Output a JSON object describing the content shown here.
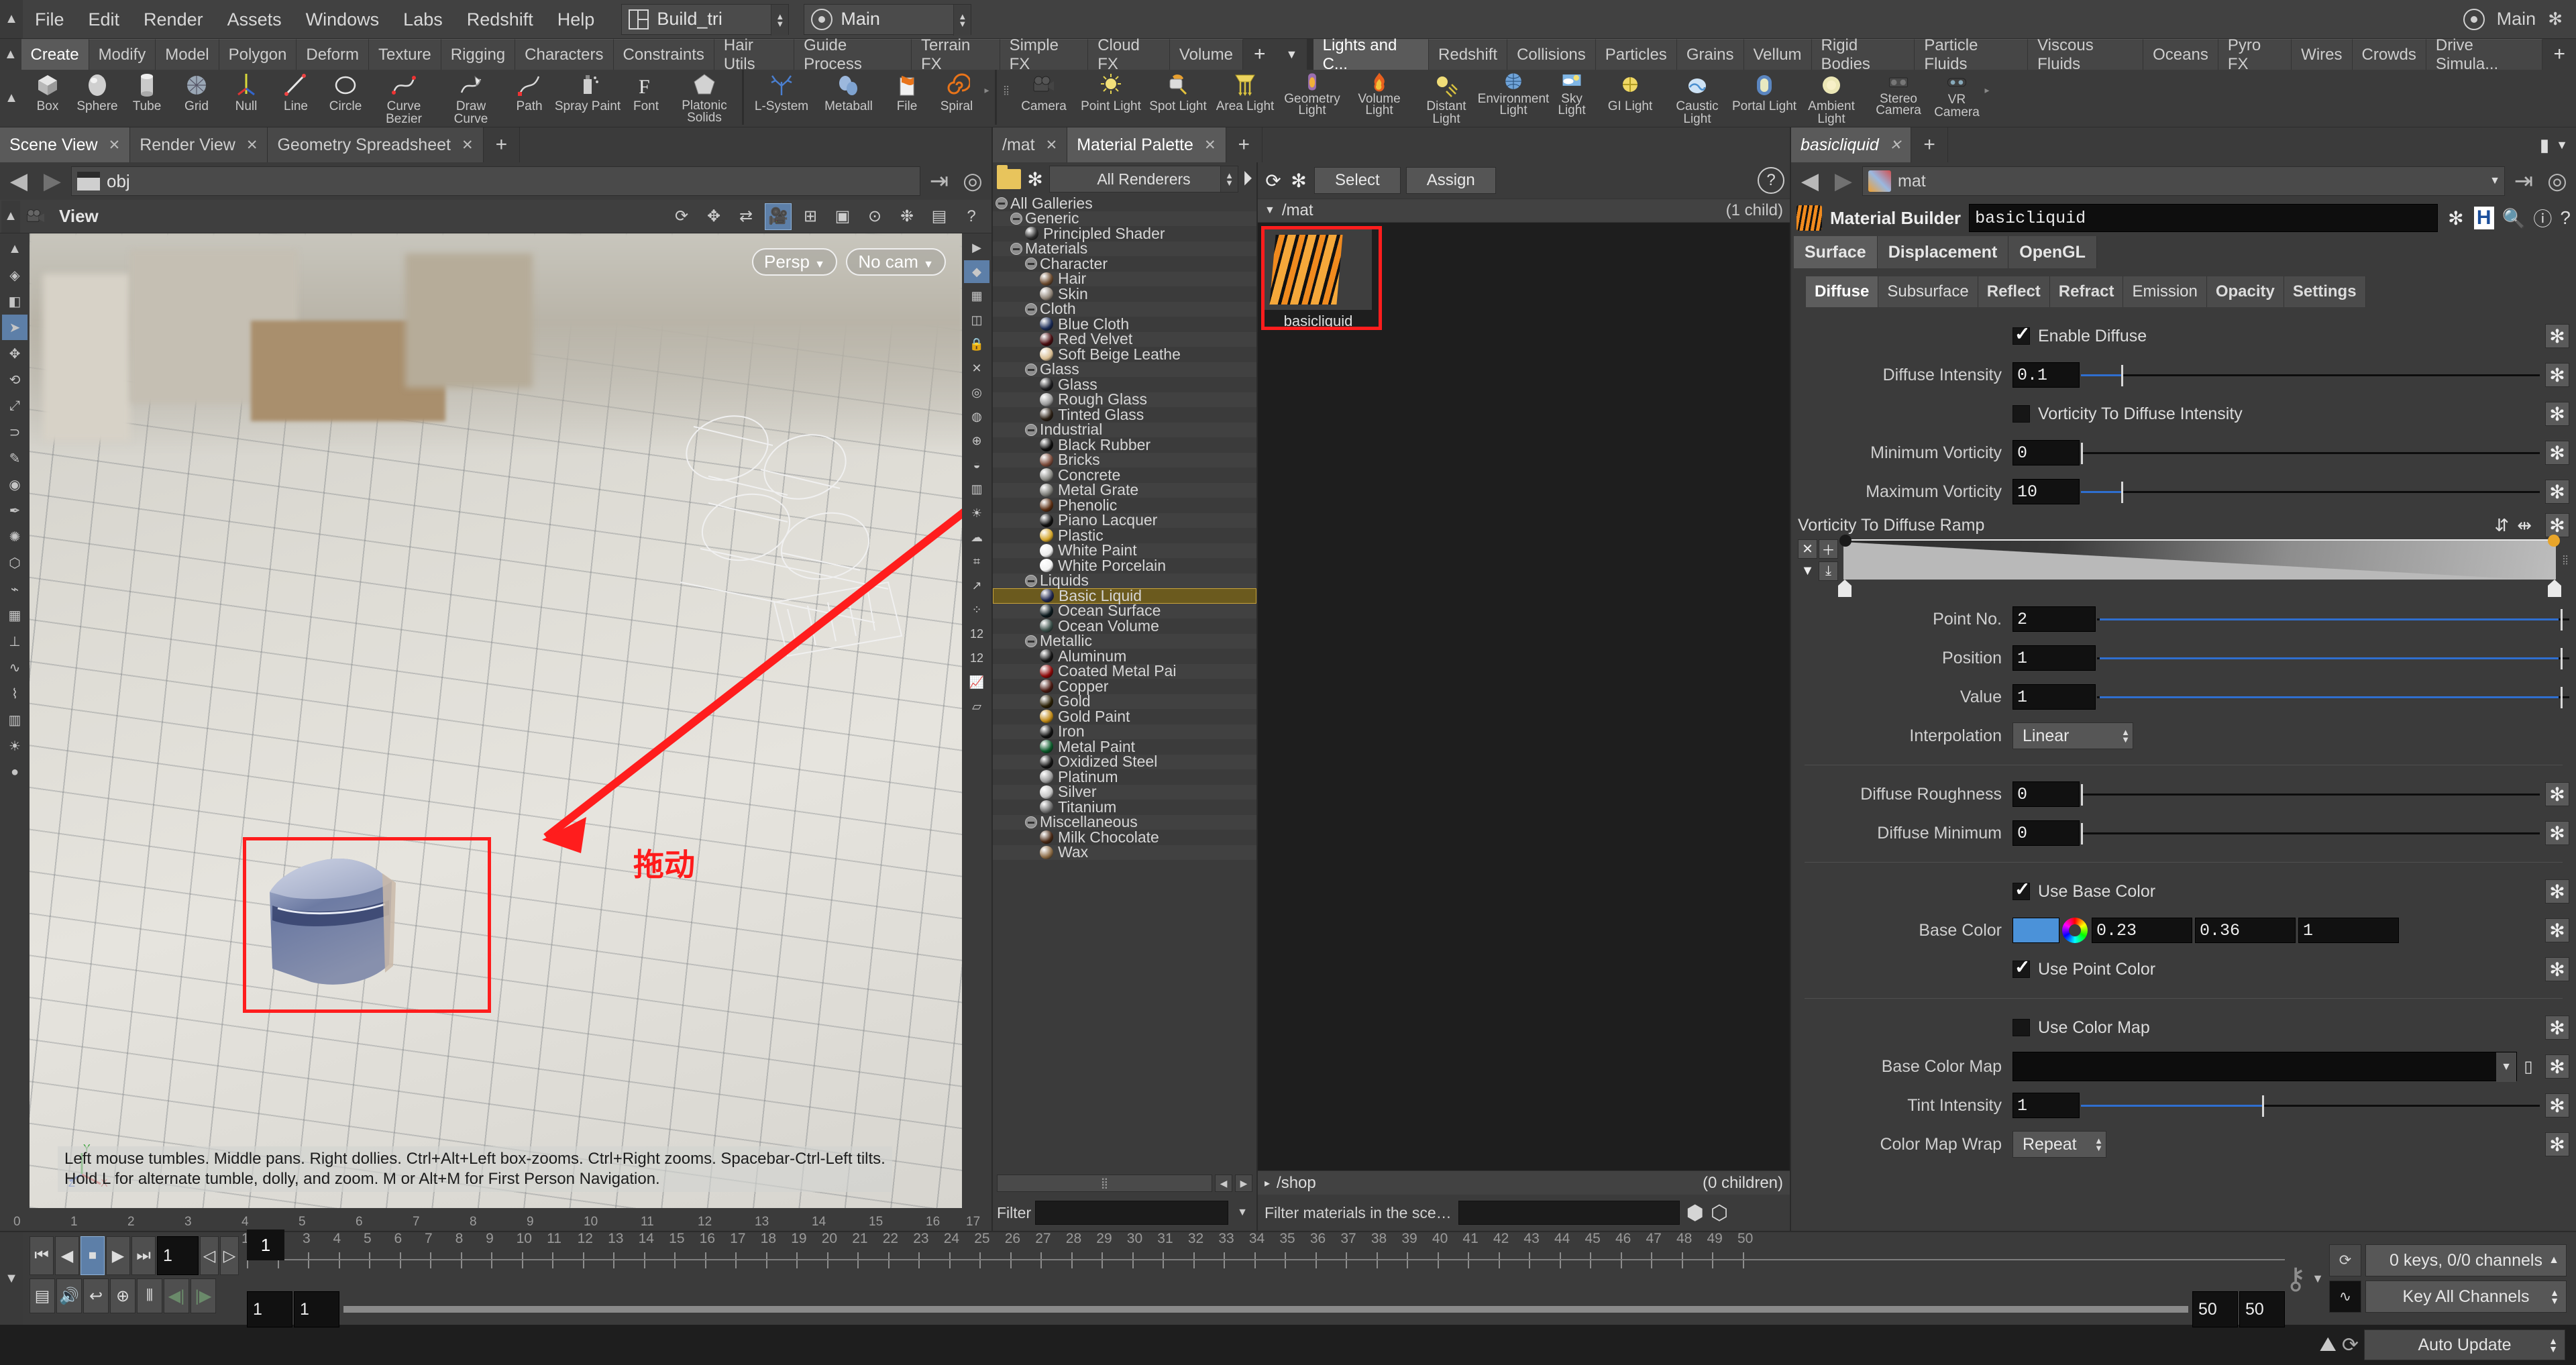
{
  "menubar": {
    "items": [
      "File",
      "Edit",
      "Render",
      "Assets",
      "Windows",
      "Labs",
      "Redshift",
      "Help"
    ],
    "desktop": "Build_tri",
    "viewport_layout": "Main",
    "right_layout": "Main"
  },
  "shelf": {
    "tabs_left": [
      "Create",
      "Modify",
      "Model",
      "Polygon",
      "Deform",
      "Texture",
      "Rigging",
      "Characters",
      "Constraints",
      "Hair Utils",
      "Guide Process",
      "Terrain FX",
      "Simple FX",
      "Cloud FX",
      "Volume"
    ],
    "active_left": "Create",
    "plus": "+",
    "caret": "▼",
    "tabs_right": [
      "Lights and C...",
      "Redshift",
      "Collisions",
      "Particles",
      "Grains",
      "Vellum",
      "Rigid Bodies",
      "Particle Fluids",
      "Viscous Fluids",
      "Oceans",
      "Pyro FX",
      "Wires",
      "Crowds",
      "Drive Simula..."
    ],
    "active_right": "Lights and C...",
    "tools_left": [
      {
        "label": "Box",
        "icon": "box-icon"
      },
      {
        "label": "Sphere",
        "icon": "sphere-icon"
      },
      {
        "label": "Tube",
        "icon": "tube-icon"
      },
      {
        "label": "Grid",
        "icon": "grid-icon"
      },
      {
        "label": "Null",
        "icon": "null-icon"
      },
      {
        "label": "Line",
        "icon": "line-icon"
      },
      {
        "label": "Circle",
        "icon": "circle-icon"
      },
      {
        "label": "Curve Bezier",
        "icon": "curve-bezier-icon"
      },
      {
        "label": "Draw Curve",
        "icon": "draw-curve-icon"
      },
      {
        "label": "Path",
        "icon": "path-icon"
      },
      {
        "label": "Spray Paint",
        "icon": "spray-paint-icon"
      },
      {
        "label": "Font",
        "icon": "font-icon"
      },
      {
        "label": "Platonic Solids",
        "icon": "platonic-solids-icon"
      },
      {
        "label": "L-System",
        "icon": "l-system-icon"
      },
      {
        "label": "Metaball",
        "icon": "metaball-icon"
      },
      {
        "label": "File",
        "icon": "file-icon"
      },
      {
        "label": "Spiral",
        "icon": "spiral-icon"
      }
    ],
    "tools_right": [
      {
        "label": "Camera",
        "icon": "camera-icon"
      },
      {
        "label": "Point Light",
        "icon": "point-light-icon"
      },
      {
        "label": "Spot Light",
        "icon": "spot-light-icon"
      },
      {
        "label": "Area Light",
        "icon": "area-light-icon"
      },
      {
        "label": "Geometry Light",
        "icon": "geometry-light-icon"
      },
      {
        "label": "Volume Light",
        "icon": "volume-light-icon"
      },
      {
        "label": "Distant Light",
        "icon": "distant-light-icon"
      },
      {
        "label": "Environment Light",
        "icon": "environment-light-icon"
      },
      {
        "label": "Sky Light",
        "icon": "sky-light-icon"
      },
      {
        "label": "GI Light",
        "icon": "gi-light-icon"
      },
      {
        "label": "Caustic Light",
        "icon": "caustic-light-icon"
      },
      {
        "label": "Portal Light",
        "icon": "portal-light-icon"
      },
      {
        "label": "Ambient Light",
        "icon": "ambient-light-icon"
      },
      {
        "label": "Stereo Camera",
        "icon": "stereo-camera-icon"
      },
      {
        "label": "VR Camera",
        "icon": "vr-camera-icon"
      }
    ]
  },
  "scene_pane": {
    "tabs": [
      "Scene View",
      "Render View",
      "Geometry Spreadsheet"
    ],
    "active_tab": "Scene View",
    "path": "obj",
    "view_label": "View",
    "persp_label": "Persp",
    "cam_label": "No cam",
    "annotation_cn": "拖动",
    "help_line1": "Left mouse tumbles. Middle pans. Right dollies. Ctrl+Alt+Left box-zooms. Ctrl+Right zooms. Spacebar-Ctrl-Left tilts.",
    "help_line2": "Hold L for alternate tumble, dolly, and zoom.     M or Alt+M for First Person Navigation.",
    "ruler_ticks": [
      "0",
      "1",
      "2",
      "3",
      "4",
      "5",
      "6",
      "7",
      "8",
      "9",
      "10",
      "11",
      "12",
      "13",
      "14",
      "15",
      "16",
      "17"
    ]
  },
  "gallery": {
    "renderer_filter": "All Renderers",
    "filter_label": "Filter",
    "filter_value": "",
    "tree": [
      {
        "label": "All Galleries",
        "depth": 0,
        "type": "node"
      },
      {
        "label": "Generic",
        "depth": 1,
        "type": "node"
      },
      {
        "label": "Principled Shader",
        "depth": 2,
        "type": "leaf",
        "color": "#2c2c2c"
      },
      {
        "label": "Materials",
        "depth": 1,
        "type": "node"
      },
      {
        "label": "Character",
        "depth": 2,
        "type": "node"
      },
      {
        "label": "Hair",
        "depth": 3,
        "type": "leaf",
        "color": "#6b4a2e"
      },
      {
        "label": "Skin",
        "depth": 3,
        "type": "leaf",
        "color": "#8f8478"
      },
      {
        "label": "Cloth",
        "depth": 2,
        "type": "node"
      },
      {
        "label": "Blue Cloth",
        "depth": 3,
        "type": "leaf",
        "color": "#1a2a55"
      },
      {
        "label": "Red Velvet",
        "depth": 3,
        "type": "leaf",
        "color": "#4a0d10"
      },
      {
        "label": "Soft Beige Leathe",
        "depth": 3,
        "type": "leaf",
        "color": "#d8bd92"
      },
      {
        "label": "Glass",
        "depth": 2,
        "type": "node"
      },
      {
        "label": "Glass",
        "depth": 3,
        "type": "leaf",
        "color": "#1d1d1f"
      },
      {
        "label": "Rough Glass",
        "depth": 3,
        "type": "leaf",
        "color": "#9a9a9a"
      },
      {
        "label": "Tinted Glass",
        "depth": 3,
        "type": "leaf",
        "color": "#2b2015"
      },
      {
        "label": "Industrial",
        "depth": 2,
        "type": "node"
      },
      {
        "label": "Black Rubber",
        "depth": 3,
        "type": "leaf",
        "color": "#0d0d0d"
      },
      {
        "label": "Bricks",
        "depth": 3,
        "type": "leaf",
        "color": "#7a4a3a"
      },
      {
        "label": "Concrete",
        "depth": 3,
        "type": "leaf",
        "color": "#8a8a85"
      },
      {
        "label": "Metal Grate",
        "depth": 3,
        "type": "leaf",
        "color": "#7b7b76"
      },
      {
        "label": "Phenolic",
        "depth": 3,
        "type": "leaf",
        "color": "#5a2e12"
      },
      {
        "label": "Piano Lacquer",
        "depth": 3,
        "type": "leaf",
        "color": "#101010"
      },
      {
        "label": "Plastic",
        "depth": 3,
        "type": "leaf",
        "color": "#d3a52b"
      },
      {
        "label": "White Paint",
        "depth": 3,
        "type": "leaf",
        "color": "#ececec"
      },
      {
        "label": "White Porcelain",
        "depth": 3,
        "type": "leaf",
        "color": "#f2f2f2"
      },
      {
        "label": "Liquids",
        "depth": 2,
        "type": "node"
      },
      {
        "label": "Basic Liquid",
        "depth": 3,
        "type": "leaf",
        "color": "#20274d",
        "selected": true
      },
      {
        "label": "Ocean Surface",
        "depth": 3,
        "type": "leaf",
        "color": "#0c1a1e"
      },
      {
        "label": "Ocean Volume",
        "depth": 3,
        "type": "leaf",
        "color": "#3a4f49"
      },
      {
        "label": "Metallic",
        "depth": 2,
        "type": "node"
      },
      {
        "label": "Aluminum",
        "depth": 3,
        "type": "leaf",
        "color": "#151515"
      },
      {
        "label": "Coated Metal Pai",
        "depth": 3,
        "type": "leaf",
        "color": "#8d0a0a"
      },
      {
        "label": "Copper",
        "depth": 3,
        "type": "leaf",
        "color": "#4a1a12"
      },
      {
        "label": "Gold",
        "depth": 3,
        "type": "leaf",
        "color": "#2a2005"
      },
      {
        "label": "Gold Paint",
        "depth": 3,
        "type": "leaf",
        "color": "#c08a18"
      },
      {
        "label": "Iron",
        "depth": 3,
        "type": "leaf",
        "color": "#111111"
      },
      {
        "label": "Metal Paint",
        "depth": 3,
        "type": "leaf",
        "color": "#0b5a2a"
      },
      {
        "label": "Oxidized Steel",
        "depth": 3,
        "type": "leaf",
        "color": "#141414"
      },
      {
        "label": "Platinum",
        "depth": 3,
        "type": "leaf",
        "color": "#9b9b9b"
      },
      {
        "label": "Silver",
        "depth": 3,
        "type": "leaf",
        "color": "#c4c4c4"
      },
      {
        "label": "Titanium",
        "depth": 3,
        "type": "leaf",
        "color": "#6d6d6d"
      },
      {
        "label": "Miscellaneous",
        "depth": 2,
        "type": "node"
      },
      {
        "label": "Milk Chocolate",
        "depth": 3,
        "type": "leaf",
        "color": "#4a2a16"
      },
      {
        "label": "Wax",
        "depth": 3,
        "type": "leaf",
        "color": "#8a6a44"
      }
    ]
  },
  "material_palette": {
    "tabs": [
      "/mat",
      "Material Palette"
    ],
    "active_tab": "Material Palette",
    "select_button": "Select",
    "assign_button": "Assign",
    "scene_header": "/mat",
    "scene_count": "(1 child)",
    "materials": [
      {
        "name": "basicliquid",
        "selected": true
      }
    ],
    "footer_path": "/shop",
    "footer_count": "(0 children)",
    "filter_label": "Filter materials in the sce…",
    "filter_value": ""
  },
  "parameters": {
    "tab_name": "basicliquid",
    "path": "mat",
    "node_type_label": "Material Builder",
    "node_name": "basicliquid",
    "context_tabs": [
      "Surface",
      "Displacement",
      "OpenGL"
    ],
    "context_active": "Surface",
    "section_tabs": [
      "Diffuse",
      "Subsurface",
      "Reflect",
      "Refract",
      "Emission",
      "Opacity",
      "Settings"
    ],
    "section_active": "Diffuse",
    "rows": {
      "enable_diffuse_label": "Enable Diffuse",
      "enable_diffuse_checked": true,
      "diffuse_intensity_label": "Diffuse Intensity",
      "diffuse_intensity_value": "0.1",
      "vorticity_to_diffuse_intensity_label": "Vorticity To Diffuse Intensity",
      "vorticity_to_diffuse_intensity_checked": false,
      "minimum_vorticity_label": "Minimum Vorticity",
      "minimum_vorticity_value": "0",
      "maximum_vorticity_label": "Maximum Vorticity",
      "maximum_vorticity_value": "10",
      "ramp_label": "Vorticity To Diffuse Ramp",
      "point_no_label": "Point No.",
      "point_no_value": "2",
      "position_label": "Position",
      "position_value": "1",
      "value_label": "Value",
      "value_value": "1",
      "interpolation_label": "Interpolation",
      "interpolation_value": "Linear",
      "diffuse_roughness_label": "Diffuse Roughness",
      "diffuse_roughness_value": "0",
      "diffuse_minimum_label": "Diffuse Minimum",
      "diffuse_minimum_value": "0",
      "use_base_color_label": "Use Base Color",
      "use_base_color_checked": true,
      "base_color_label": "Base Color",
      "base_color_swatch": "#4b92d9",
      "base_color_r": "0.23",
      "base_color_g": "0.36",
      "base_color_b": "1",
      "use_point_color_label": "Use Point Color",
      "use_point_color_checked": true,
      "use_color_map_label": "Use Color Map",
      "use_color_map_checked": false,
      "base_color_map_label": "Base Color Map",
      "base_color_map_value": "",
      "tint_intensity_label": "Tint Intensity",
      "tint_intensity_value": "1",
      "color_map_wrap_label": "Color Map Wrap",
      "color_map_wrap_value": "Repeat"
    }
  },
  "timeline": {
    "current_frame": "1",
    "range_start": "1",
    "range_start2": "1",
    "range_end": "50",
    "range_end2": "50",
    "keys_status": "0 keys, 0/0 channels",
    "key_mode": "Key All Channels",
    "auto_update": "Auto Update",
    "ticks": [
      "1",
      "2",
      "3",
      "4",
      "5",
      "6",
      "7",
      "8",
      "9",
      "10",
      "11",
      "12",
      "13",
      "14",
      "15",
      "16",
      "17",
      "18",
      "19",
      "20",
      "21",
      "22",
      "23",
      "24",
      "25",
      "26",
      "27",
      "28",
      "29",
      "30",
      "31",
      "32",
      "33",
      "34",
      "35",
      "36",
      "37",
      "38",
      "39",
      "40",
      "41",
      "42",
      "43",
      "44",
      "45",
      "46",
      "47",
      "48",
      "49",
      "50"
    ]
  }
}
